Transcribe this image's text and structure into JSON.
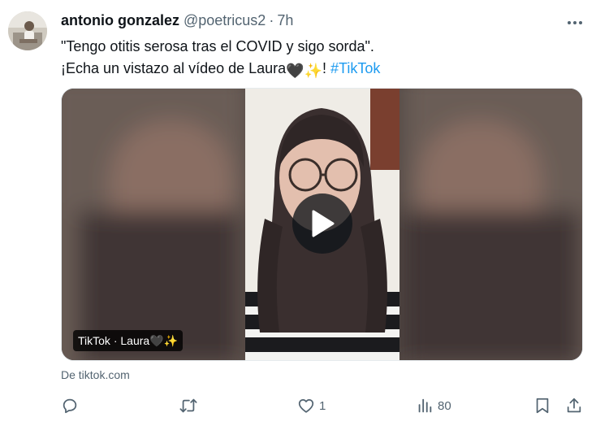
{
  "author": {
    "name": "antonio gonzalez",
    "handle": "@poetricus2",
    "separator": "·",
    "time": "7h"
  },
  "tweet": {
    "line1": "\"Tengo otitis serosa tras el COVID y sigo sorda\".",
    "line2_prefix": "¡Echa un vistazo al vídeo de Laura",
    "line2_emoji_heart": "🖤",
    "line2_emoji_sparkle": "✨",
    "line2_exclaim": "! ",
    "hashtag": "#TikTok"
  },
  "media": {
    "label_text": "TikTok · Laura",
    "label_emoji_heart": "🖤",
    "label_emoji_sparkle": "✨"
  },
  "source": "De tiktok.com",
  "actions": {
    "reply_count": "",
    "retweet_count": "",
    "like_count": "1",
    "views_count": "80"
  },
  "icons": [
    "more-icon",
    "reply-icon",
    "retweet-icon",
    "like-icon",
    "views-icon",
    "bookmark-icon",
    "share-icon",
    "play-icon"
  ],
  "colors": {
    "text": "#0f1419",
    "secondary": "#536471",
    "link": "#1d9bf0"
  }
}
